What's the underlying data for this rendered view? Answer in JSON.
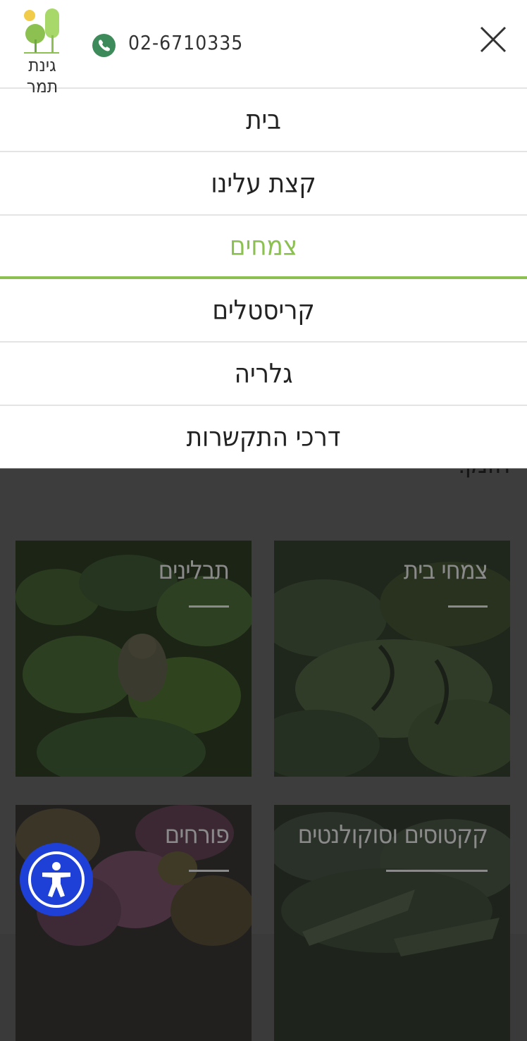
{
  "header": {
    "logo_text": "גינת תמר",
    "phone_number": "02-6710335"
  },
  "nav": {
    "items": [
      {
        "label": "בית",
        "active": false
      },
      {
        "label": "קצת עלינו",
        "active": false
      },
      {
        "label": "צמחים",
        "active": true
      },
      {
        "label": "קריסטלים",
        "active": false
      },
      {
        "label": "גלריה",
        "active": false
      },
      {
        "label": "דרכי התקשרות",
        "active": false
      }
    ]
  },
  "background": {
    "intro_text": "הזמן.",
    "tiles": [
      {
        "title": "צמחי בית",
        "icon": "foliage-photo"
      },
      {
        "title": "תבלינים",
        "icon": "basil-photo"
      },
      {
        "title": "קקטוסים וסוקולנטים",
        "icon": "succulent-photo"
      },
      {
        "title": "פורחים",
        "icon": "flowers-photo"
      }
    ]
  },
  "colors": {
    "accent": "#8cc152",
    "phone_icon": "#3d8a5a",
    "accessibility_button": "#1e40d6"
  }
}
